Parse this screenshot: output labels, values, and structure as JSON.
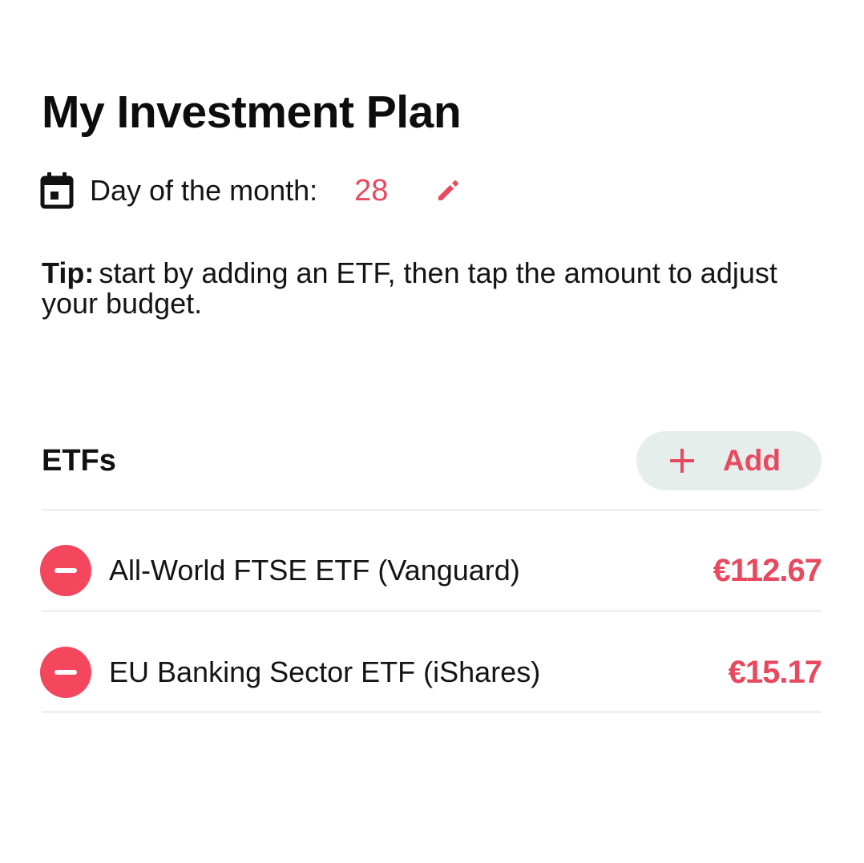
{
  "page": {
    "title": "My Investment Plan"
  },
  "schedule": {
    "icon": "calendar-icon",
    "label": "Day of the month:",
    "value": "28",
    "edit_icon": "pencil-icon"
  },
  "tip": {
    "prefix": "Tip:",
    "text": "start by adding an ETF, then tap the amount to adjust your budget."
  },
  "etfs": {
    "heading": "ETFs",
    "add_button_label": "Add",
    "add_icon": "plus-icon",
    "items": [
      {
        "name": "All-World FTSE ETF (Vanguard)",
        "amount": "€112.67",
        "remove_icon": "minus-icon"
      },
      {
        "name": "EU Banking Sector ETF (iShares)",
        "amount": "€15.17",
        "remove_icon": "minus-icon"
      }
    ]
  },
  "colors": {
    "accent": "#e8495f",
    "remove_button": "#f4475d",
    "add_button_background": "#e6eeeb",
    "divider": "#edf1ef",
    "text": "#111111",
    "background": "#ffffff"
  }
}
